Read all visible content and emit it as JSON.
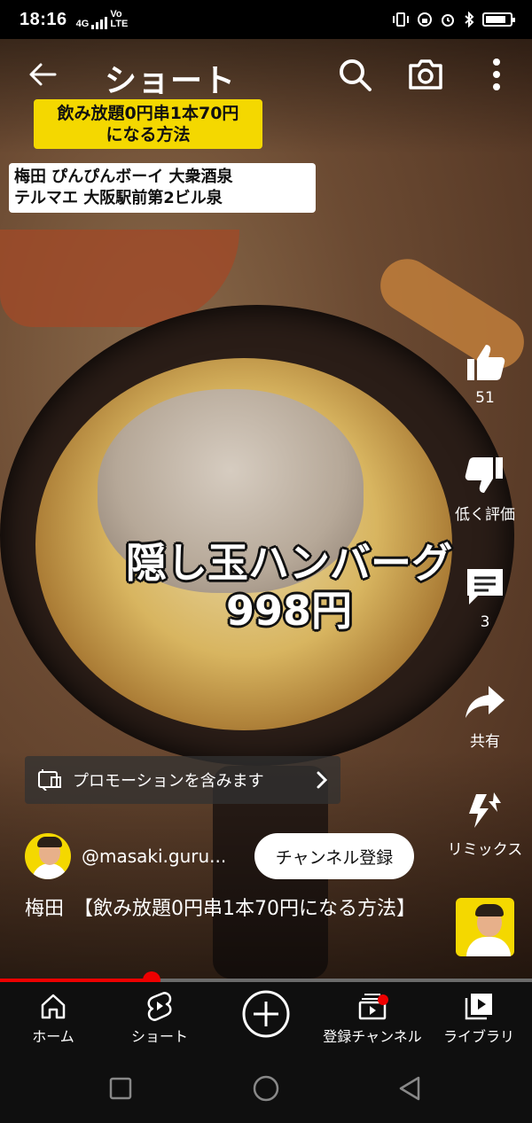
{
  "status_bar": {
    "time": "18:16",
    "network_label": "4G",
    "volte_label": "Vo\nLTE"
  },
  "header": {
    "title": "ショート"
  },
  "video": {
    "caption_top": "飲み放題0円串1本70円\nになる方法",
    "caption_shops": "梅田 ぴんぴんボーイ 大衆酒泉\nテルマエ 大阪駅前第2ビル泉",
    "overlay_text": "隠し玉ハンバーグ\n998円",
    "progress_fraction": 0.285
  },
  "actions": {
    "like_count": "51",
    "dislike_label": "低く評価",
    "comment_count": "3",
    "share_label": "共有",
    "remix_label": "リミックス"
  },
  "promotion": {
    "label": "プロモーションを含みます"
  },
  "channel": {
    "handle": "@masaki.guru...",
    "subscribe_label": "チャンネル登録",
    "description": "梅田　【飲み放題0円串1本70円になる方法】"
  },
  "bottom_nav": {
    "home": "ホーム",
    "shorts": "ショート",
    "subscriptions": "登録チャンネル",
    "library": "ライブラリ"
  },
  "colors": {
    "accent_red": "#ee0000",
    "caption_yellow": "#f4d800",
    "nav_background": "#0f0f0f"
  }
}
